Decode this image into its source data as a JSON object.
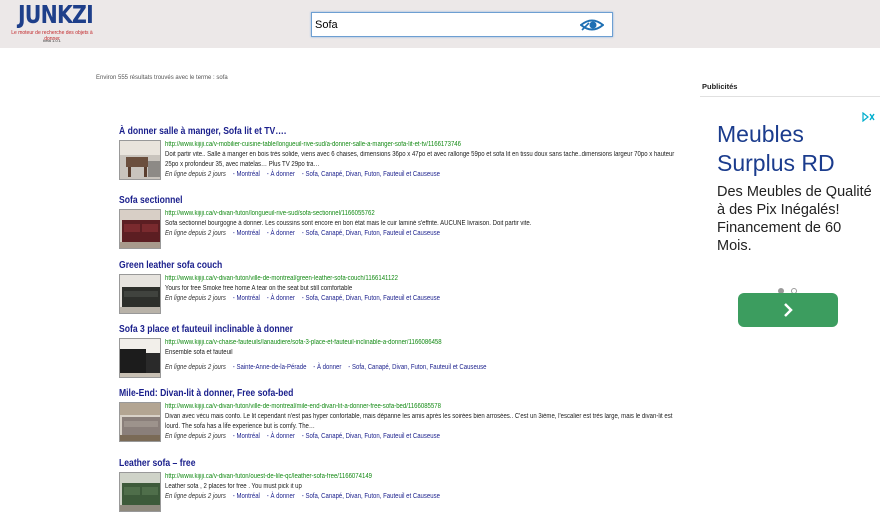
{
  "header": {
    "logo": "JUNKZI",
    "tagline": "Le moteur de recherche des objets à donner",
    "version": "beta 1.0.1",
    "search": {
      "value": "Sofa",
      "icon": "eye-search-icon"
    }
  },
  "results_info": "Environ 555 résultats trouvés avec le terme : sofa",
  "ads_label": "Publicités",
  "results": [
    {
      "title": "À donner salle à manger, Sofa lit et TV….",
      "url": "http://www.kijiji.ca/v-mobilier-cuisine-table/longueuil-rive-sud/a-donner-salle-a-manger-sofa-lit-et-tv/1166173746",
      "desc": "Doit partir vite.. Salle à manger en bois très solide, viens avec 6 chaises, dimensions 36po x 47po et avec rallonge 59po et sofa lit en tissu doux sans tache..dimensions largeur 70po x hauteur 25po x profondeur 35, avec matelas… Plus TV 29po tra…",
      "time": "En ligne depuis 2 jours",
      "links": [
        "- Montréal",
        "- À donner",
        "- Sofa, Canapé, Divan, Futon, Fauteuil et Causeuse"
      ]
    },
    {
      "title": "Sofa sectionnel",
      "url": "http://www.kijiji.ca/v-divan-futon/longueuil-rive-sud/sofa-sectionnel/1166055762",
      "desc": "Sofa sectionnel bourgogne à donner. Les coussins sont encore en bon état mais le cuir laminé s'effrite. AUCUNE livraison. Doit partir vite.",
      "time": "En ligne depuis 2 jours",
      "links": [
        "- Montréal",
        "- À donner",
        "- Sofa, Canapé, Divan, Futon, Fauteuil et Causeuse"
      ]
    },
    {
      "title": "Green leather sofa couch",
      "url": "http://www.kijiji.ca/v-divan-futon/ville-de-montreal/green-leather-sofa-couch/1166141122",
      "desc": "Yours for free Smoke free home A tear on the seat but still comfortable",
      "time": "En ligne depuis 2 jours",
      "links": [
        "- Montréal",
        "- À donner",
        "- Sofa, Canapé, Divan, Futon, Fauteuil et Causeuse"
      ]
    },
    {
      "title": "Sofa 3 place et fauteuil inclinable à donner",
      "url": "http://www.kijiji.ca/v-chaise-fauteuils/lanaudiere/sofa-3-place-et-fauteuil-inclinable-a-donner/1166086458",
      "desc": "Ensemble sofa et fauteuil",
      "time": "En ligne depuis 2 jours",
      "links": [
        "- Sainte-Anne-de-la-Pérade",
        "- À donner",
        "- Sofa, Canapé, Divan, Futon, Fauteuil et Causeuse"
      ]
    },
    {
      "title": "Mile-End: Divan-lit à donner, Free sofa-bed",
      "url": "http://www.kijiji.ca/v-divan-futon/ville-de-montreal/mile-end-divan-lit-a-donner-free-sofa-bed/1166085578",
      "desc": "Divan avec vécu mais confo. Le lit cependant n'est pas hyper confortable, mais dépanne les amis après les soirées bien arrosées.. C'est un 3ième, l'escalier est très large, mais le divan-lit est lourd. The sofa has a life experience but is comfy. The…",
      "time": "En ligne depuis 2 jours",
      "links": [
        "- Montréal",
        "- À donner",
        "- Sofa, Canapé, Divan, Futon, Fauteuil et Causeuse"
      ]
    },
    {
      "title": "Leather sofa – free",
      "url": "http://www.kijiji.ca/v-divan-futon/ouest-de-lile-qc/leather-sofa-free/1166074149",
      "desc": "Leather sofa , 2 places for free . You must pick it up",
      "time": "En ligne depuis 2 jours",
      "links": [
        "- Montréal",
        "- À donner",
        "- Sofa, Canapé, Divan, Futon, Fauteuil et Causeuse"
      ]
    }
  ],
  "ad": {
    "title": "Meubles Surplus RD",
    "text": "Des Meubles de Qualité à des Pix Inégalés! Financement de 60 Mois.",
    "accent": "#3c9d5f",
    "title_color": "#1b3c8d"
  }
}
